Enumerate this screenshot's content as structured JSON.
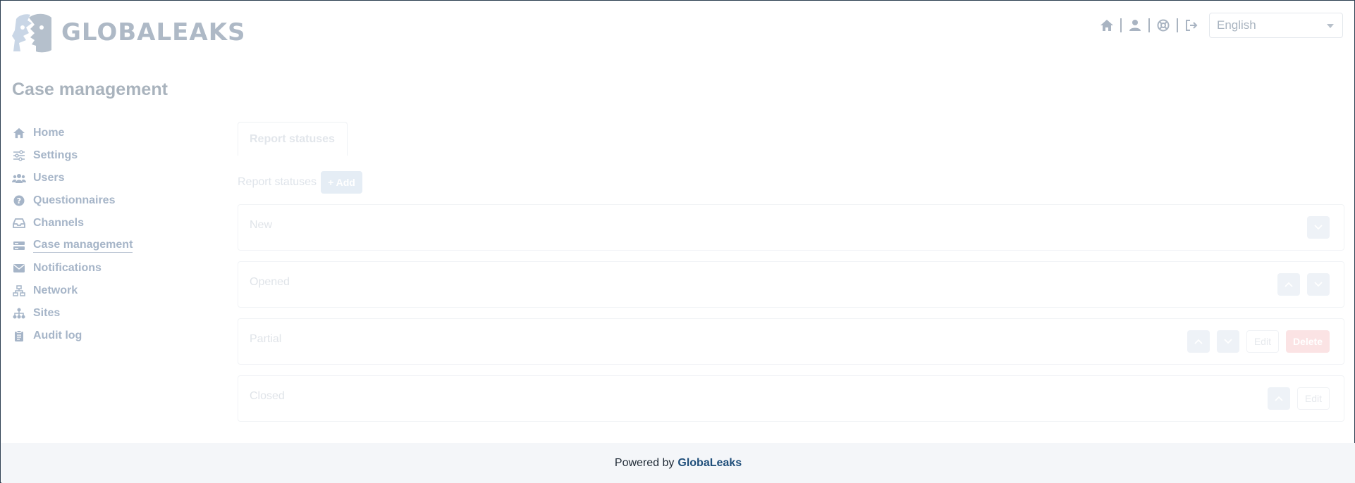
{
  "header": {
    "logo_text": "GLOBALEAKS",
    "language": {
      "selected": "English"
    },
    "icons": [
      "home-icon",
      "user-icon",
      "support-icon",
      "logout-icon"
    ]
  },
  "page": {
    "title": "Case management"
  },
  "sidebar": {
    "items": [
      {
        "label": "Home",
        "icon": "home-icon",
        "active": false
      },
      {
        "label": "Settings",
        "icon": "sliders-icon",
        "active": false
      },
      {
        "label": "Users",
        "icon": "users-icon",
        "active": false
      },
      {
        "label": "Questionnaires",
        "icon": "question-circle-icon",
        "active": false
      },
      {
        "label": "Channels",
        "icon": "inbox-icon",
        "active": false
      },
      {
        "label": "Case management",
        "icon": "server-icon",
        "active": true
      },
      {
        "label": "Notifications",
        "icon": "envelope-icon",
        "active": false
      },
      {
        "label": "Network",
        "icon": "network-icon",
        "active": false
      },
      {
        "label": "Sites",
        "icon": "sitemap-icon",
        "active": false
      },
      {
        "label": "Audit log",
        "icon": "clipboard-icon",
        "active": false
      }
    ]
  },
  "main": {
    "tab_label": "Report statuses",
    "section_label": "Report statuses",
    "add_label": "+ Add",
    "statuses": [
      {
        "name": "New"
      },
      {
        "name": "Opened"
      },
      {
        "name": "Partial",
        "edit_label": "Edit",
        "delete_label": "Delete"
      },
      {
        "name": "Closed",
        "edit_label": "Edit"
      }
    ]
  },
  "footer": {
    "prefix": "Powered by",
    "link": "GlobaLeaks"
  },
  "colors": {
    "accent": "#1f4e7a",
    "sidebar_text": "#a6b5c8",
    "footer_bg": "#f4f6f9",
    "danger_faded": "#fbe3e4"
  }
}
